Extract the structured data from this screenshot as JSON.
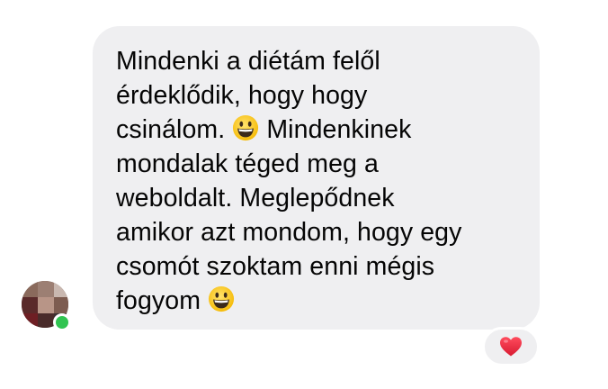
{
  "message": {
    "lines": [
      "Mindenki a diétám felől",
      "érdeklődik, hogy hogy",
      "csinálom.",
      "Mindenkinek",
      "mondalak téged meg a",
      "weboldalt. Meglepődnek",
      "amikor azt mondom, hogy egy",
      "csomót szoktam enni mégis",
      "fogyom"
    ],
    "emoji": "grinning-face-icon"
  },
  "sender": {
    "status": "online"
  },
  "reaction": {
    "icon": "heart-icon",
    "color": "#e0245e"
  },
  "colors": {
    "bubble": "#efeff1",
    "online": "#31c451"
  }
}
